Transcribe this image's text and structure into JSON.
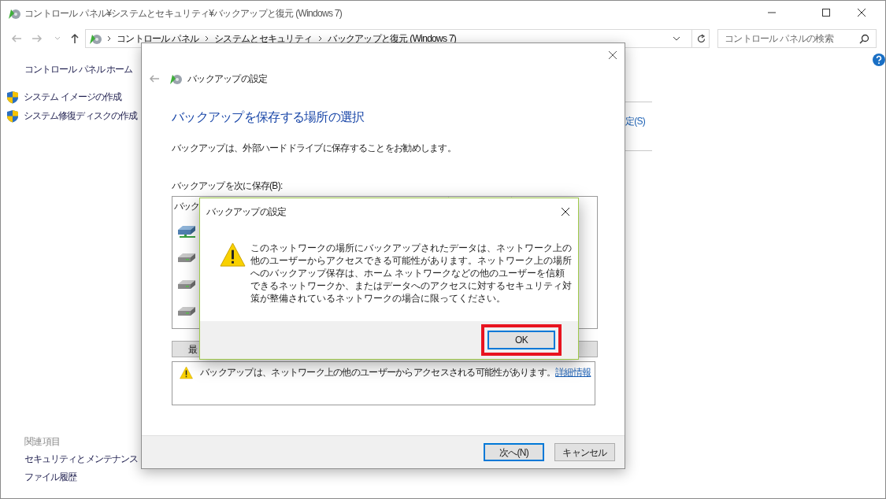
{
  "window": {
    "title": "コントロール パネル¥システムとセキュリティ¥バックアップと復元 (Windows 7)",
    "crumbs": [
      "コントロール パネル",
      "システムとセキュリティ",
      "バックアップと復元 (Windows 7)"
    ],
    "search": {
      "placeholder": "コントロール パネルの検索"
    }
  },
  "sidebar": {
    "items": [
      {
        "label": "コントロール パネル ホーム",
        "kind": "plain"
      },
      {
        "label": "システム イメージの作成",
        "kind": "shield"
      },
      {
        "label": "システム修復ディスクの作成",
        "kind": "shield"
      }
    ],
    "related_heading": "関連項目",
    "related": [
      "セキュリティとメンテナンス",
      "ファイル履歴"
    ]
  },
  "main": {
    "partial_link": "定(S)"
  },
  "wizard": {
    "title": "バックアップの設定",
    "heading": "バックアップを保存する場所の選択",
    "description": "バックアップは、外部ハードドライブに保存することをお勧めします。",
    "list_label": "バックアップを次に保存(B):",
    "list_header": "バック",
    "drives": [
      {
        "kind": "network"
      },
      {
        "kind": "disk"
      },
      {
        "kind": "disk"
      },
      {
        "kind": "disk"
      }
    ],
    "partial_button": "最",
    "warning": {
      "text": "バックアップは、ネットワーク上の他のユーザーからアクセスされる可能性があります。",
      "link": "詳細情報"
    },
    "buttons": [
      {
        "label": "次へ(N)",
        "default": true
      },
      {
        "label": "キャンセル",
        "default": false
      }
    ]
  },
  "message": {
    "title": "バックアップの設定",
    "text": "このネットワークの場所にバックアップされたデータは、ネットワーク上の他のユーザーからアクセスできる可能性があります。ネットワーク上の場所へのバックアップ保存は、ホーム ネットワークなどの他のユーザーを信頼できるネットワークか、またはデータへのアクセスに対するセキュリティ対策が整備されているネットワークの場合に限ってください。",
    "button": "OK",
    "highlighted": true
  }
}
